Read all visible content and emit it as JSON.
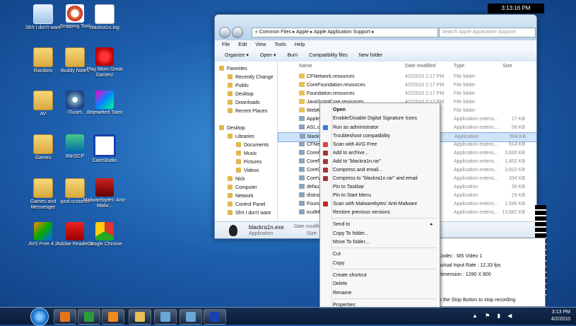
{
  "desktop": {
    "icons": [
      {
        "label": "Sh!t I don't want",
        "glyph": "g-bin",
        "icon": "recycle-bin-icon"
      },
      {
        "label": "Snipping Tool",
        "glyph": "g-scis",
        "icon": "snipping-tool-icon"
      },
      {
        "label": "blackra1n.log",
        "glyph": "g-doc",
        "icon": "text-file-icon"
      },
      {
        "label": "Random",
        "glyph": "g-folder",
        "icon": "folder-icon"
      },
      {
        "label": "Buddy Notes",
        "glyph": "g-folder",
        "icon": "folder-icon"
      },
      {
        "label": "Play More Great Games!",
        "glyph": "g-popcap",
        "icon": "popcap-icon"
      },
      {
        "label": "AV",
        "glyph": "g-folder",
        "icon": "folder-icon"
      },
      {
        "label": "iTunes",
        "glyph": "g-itunes",
        "icon": "itunes-icon"
      },
      {
        "label": "Bejeweled Twist",
        "glyph": "g-bej",
        "icon": "bejeweled-icon"
      },
      {
        "label": "Games",
        "glyph": "g-folder",
        "icon": "folder-icon"
      },
      {
        "label": "WinSCP",
        "glyph": "g-winscp",
        "icon": "winscp-icon"
      },
      {
        "label": "CamStudio",
        "glyph": "g-cam",
        "icon": "camstudio-icon"
      },
      {
        "label": "Games and Messenger",
        "glyph": "g-folder",
        "icon": "folder-icon"
      },
      {
        "label": "ipod customs",
        "glyph": "g-folder",
        "icon": "folder-icon"
      },
      {
        "label": "Malwarebytes' Anti-Malw...",
        "glyph": "g-mal",
        "icon": "malwarebytes-icon"
      },
      {
        "label": "AVS Free 4.2",
        "glyph": "g-avs",
        "icon": "avs-icon"
      },
      {
        "label": "Adobe Reader 9",
        "glyph": "g-pdf",
        "icon": "adobe-reader-icon"
      },
      {
        "label": "Google Chrome",
        "glyph": "g-chrome",
        "icon": "chrome-icon"
      }
    ]
  },
  "explorer": {
    "breadcrumb": "«  Common Files  ▸  Apple  ▸  Apple Application Support  ▸",
    "search_placeholder": "Search Apple Application Support",
    "menu": [
      "File",
      "Edit",
      "View",
      "Tools",
      "Help"
    ],
    "toolbar": [
      "Organize ▾",
      "Open ▾",
      "Burn",
      "Compatibility files",
      "New folder"
    ],
    "nav": [
      "Favorites",
      "Recently Change",
      "Public",
      "Desktop",
      "Downloads",
      "Recent Places",
      "Desktop",
      "Libraries",
      "Documents",
      "Music",
      "Pictures",
      "Videos",
      "Nick",
      "Computer",
      "Network",
      "Control Panel",
      "Sh!t I don't want"
    ],
    "columns": {
      "name": "Name",
      "date": "Date modified",
      "type": "Type",
      "size": "Size"
    },
    "files": [
      {
        "name": "CFNetwork.resources",
        "date": "4/2/2010 2:17 PM",
        "type": "File folder",
        "size": ""
      },
      {
        "name": "CoreFoundation.resources",
        "date": "4/2/2010 2:17 PM",
        "type": "File folder",
        "size": ""
      },
      {
        "name": "Foundation.resources",
        "date": "4/2/2010 2:17 PM",
        "type": "File folder",
        "size": ""
      },
      {
        "name": "JavaScriptCore.resources",
        "date": "4/2/2010 2:17 PM",
        "type": "File folder",
        "size": ""
      },
      {
        "name": "WebKit",
        "date": "",
        "type": "File folder",
        "size": ""
      },
      {
        "name": "AppleV",
        "date": "",
        "type": "Application extens...",
        "size": "17 KB"
      },
      {
        "name": "ASL.dll",
        "date": "",
        "type": "Application extens...",
        "size": "58 KB"
      },
      {
        "name": "blackra",
        "date": "",
        "type": "Application",
        "size": "594 KB"
      },
      {
        "name": "CFNetw",
        "date": "",
        "type": "Application extens...",
        "size": "614 KB"
      },
      {
        "name": "CoreAu",
        "date": "",
        "type": "Application extens...",
        "size": "3,630 KB"
      },
      {
        "name": "CoreFo",
        "date": "",
        "type": "Application extens...",
        "size": "1,852 KB"
      },
      {
        "name": "CoreGr",
        "date": "",
        "type": "Application extens...",
        "size": "3,822 KB"
      },
      {
        "name": "CoreVi",
        "date": "",
        "type": "Application extens...",
        "size": "334 KB"
      },
      {
        "name": "default",
        "date": "",
        "type": "Application",
        "size": "30 KB"
      },
      {
        "name": "distnot",
        "date": "",
        "type": "Application",
        "size": "29 KB"
      },
      {
        "name": "Found",
        "date": "",
        "type": "Application extens...",
        "size": "1,546 KB"
      },
      {
        "name": "icudt4",
        "date": "",
        "type": "Application extens...",
        "size": "13,682 KB"
      }
    ],
    "details": {
      "name": "blackra1n.exe",
      "kind": "Application",
      "date_label": "Date modified: 4",
      "size_label": "Size: 5"
    }
  },
  "context_menu": {
    "items": [
      {
        "label": "Open",
        "bold": true,
        "icon": ""
      },
      {
        "label": "Enable/Disable Digital Signature Icons",
        "icon": ""
      },
      {
        "label": "Run as administrator",
        "icon": "#3a7bd5"
      },
      {
        "label": "Troubleshoot compatibility",
        "icon": ""
      },
      {
        "label": "Scan with AVG Free",
        "icon": "#d44"
      },
      {
        "label": "Add to archive...",
        "icon": "#a33"
      },
      {
        "label": "Add to \"blackra1n.rar\"",
        "icon": "#a33"
      },
      {
        "label": "Compress and email...",
        "icon": "#a33"
      },
      {
        "label": "Compress to \"blackra1n.rar\" and email",
        "icon": "#a33"
      },
      {
        "label": "Pin to Taskbar",
        "icon": ""
      },
      {
        "label": "Pin to Start Menu",
        "icon": ""
      },
      {
        "label": "Scan with Malwarebytes' Anti-Malware",
        "icon": "#c22"
      },
      {
        "label": "Restore previous versions",
        "icon": ""
      },
      {
        "label": "Send to",
        "icon": "",
        "arrow": "▸"
      },
      {
        "label": "Copy To folder...",
        "icon": ""
      },
      {
        "label": "Move To folder...",
        "icon": ""
      },
      {
        "label": "Cut",
        "icon": ""
      },
      {
        "label": "Copy",
        "icon": ""
      },
      {
        "label": "Create shortcut",
        "icon": ""
      },
      {
        "label": "Delete",
        "icon": ""
      },
      {
        "label": "Rename",
        "icon": ""
      },
      {
        "label": "Properties",
        "icon": ""
      }
    ]
  },
  "recorder": {
    "clock": "3:13:16 PM",
    "codec": "Codec : MS Video 1",
    "rate": "Actual Input Rate : 12.33 fps",
    "dimension": "Dimension : 1280 X 800",
    "hint": "ss the Stop Button to stop recording"
  },
  "taskbar": {
    "time": "3:13 PM",
    "date": "4/2/2010",
    "buttons": [
      "firefox-icon",
      "chrome-icon",
      "media-player-icon",
      "explorer-icon",
      "itunes-icon",
      "itunes-icon",
      "camstudio-icon"
    ],
    "colors": [
      "#e8731b",
      "#2a9d3a",
      "#f08a1c",
      "#e7c154",
      "#6aa7d8",
      "#6aa7d8",
      "#1a3fb0"
    ]
  }
}
